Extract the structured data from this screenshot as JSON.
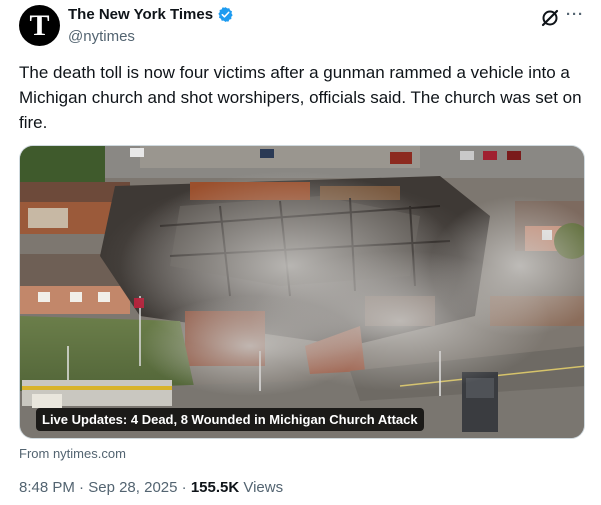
{
  "author": {
    "avatar_letter": "T",
    "name": "The New York Times",
    "handle": "@nytimes",
    "verified_icon": "verified-badge-icon"
  },
  "header_actions": {
    "grok_icon": "grok-icon",
    "more_label": "···"
  },
  "tweet": {
    "text": "The death toll is now four victims after a gunman rammed a vehicle into a Michigan church and shot worshipers, officials said. The church was set on fire."
  },
  "media": {
    "caption": "Live Updates: 4 Dead, 8 Wounded in Michigan Church Attack",
    "image_subject": "aerial-burned-church-photo"
  },
  "link_source": "From nytimes.com",
  "meta": {
    "time": "8:48 PM",
    "separator": "·",
    "date": "Sep 28, 2025",
    "views_count": "155.5K",
    "views_label": "Views"
  },
  "colors": {
    "text": "#0f1419",
    "secondary": "#536471",
    "verified": "#1d9bf0",
    "border": "#cfd9de"
  }
}
